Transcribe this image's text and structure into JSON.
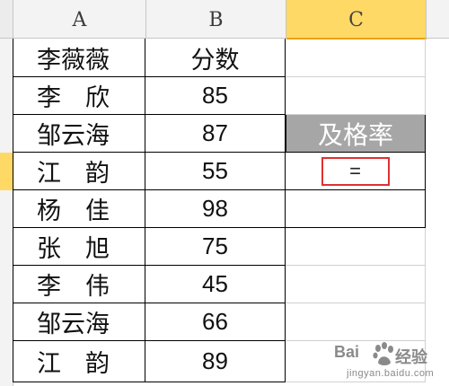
{
  "columns": [
    "A",
    "B",
    "C"
  ],
  "selected_column": "C",
  "header_row": {
    "name": "李薇薇",
    "score": "分数"
  },
  "rows": [
    {
      "name": "李　欣",
      "score": "85"
    },
    {
      "name": "邹云海",
      "score": "87"
    },
    {
      "name": "江　韵",
      "score": "55"
    },
    {
      "name": "杨　佳",
      "score": "98"
    },
    {
      "name": "张　旭",
      "score": "75"
    },
    {
      "name": "李　伟",
      "score": "45"
    },
    {
      "name": "邹云海",
      "score": "66"
    },
    {
      "name": "江　韵",
      "score": "89"
    }
  ],
  "pass_rate": {
    "label": "及格率",
    "formula": "="
  },
  "watermark": {
    "brand": "Bai",
    "suffix": "经验",
    "url": "jingyan.baidu.com"
  },
  "colors": {
    "selected_header": "#ffd966",
    "label_fill": "#a6a6a6",
    "formula_border": "#e03030"
  }
}
